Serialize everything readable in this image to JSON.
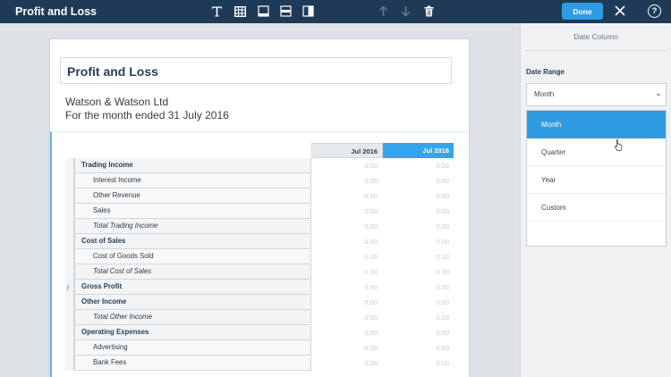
{
  "app": {
    "title": "Profit and Loss"
  },
  "toolbar": {
    "icons": [
      "text-icon",
      "table-icon",
      "align-bottom-icon",
      "align-middle-icon",
      "column-split-icon",
      "arrow-up-icon",
      "arrow-down-icon",
      "trash-icon"
    ],
    "done_label": "Done",
    "help_label": "?"
  },
  "report": {
    "title": "Profit and Loss",
    "company": "Watson & Watson Ltd",
    "period": "For the month ended 31 July 2016",
    "columns": [
      "Jul 2016",
      "Jul 2016"
    ],
    "rows": [
      {
        "label": "Trading Income",
        "kind": "head",
        "values": [
          "0.00",
          "0.00"
        ]
      },
      {
        "label": "Interest Income",
        "kind": "child",
        "values": [
          "0.00",
          "0.00"
        ]
      },
      {
        "label": "Other Revenue",
        "kind": "child",
        "values": [
          "0.00",
          "0.00"
        ]
      },
      {
        "label": "Sales",
        "kind": "child",
        "values": [
          "0.00",
          "0.00"
        ]
      },
      {
        "label": "Total Trading Income",
        "kind": "total",
        "values": [
          "0.00",
          "0.00"
        ]
      },
      {
        "label": "Cost of Sales",
        "kind": "head",
        "values": [
          "0.00",
          "0.00"
        ]
      },
      {
        "label": "Cost of Goods Sold",
        "kind": "child",
        "values": [
          "0.00",
          "0.00"
        ]
      },
      {
        "label": "Total Cost of Sales",
        "kind": "total",
        "values": [
          "0.00",
          "0.00"
        ]
      },
      {
        "label": "Gross Profit",
        "kind": "formula",
        "values": [
          "0.00",
          "0.00"
        ]
      },
      {
        "label": "Other Income",
        "kind": "head",
        "values": [
          "0.00",
          "0.00"
        ]
      },
      {
        "label": "Total Other Income",
        "kind": "total",
        "values": [
          "0.00",
          "0.00"
        ]
      },
      {
        "label": "Operating Expenses",
        "kind": "head",
        "values": [
          "0.00",
          "0.00"
        ]
      },
      {
        "label": "Advertising",
        "kind": "child",
        "values": [
          "0.00",
          "0.00"
        ]
      },
      {
        "label": "Bank Fees",
        "kind": "child",
        "values": [
          "0.00",
          "0.00"
        ]
      }
    ]
  },
  "panel": {
    "title": "Date Column",
    "field_label": "Date Range",
    "selected": "Month",
    "options": [
      "Month",
      "Quarter",
      "Year",
      "Custom"
    ]
  },
  "colors": {
    "topbar": "#1f3a56",
    "accent": "#2f9be2",
    "highlight_column": "#33a5e8"
  }
}
